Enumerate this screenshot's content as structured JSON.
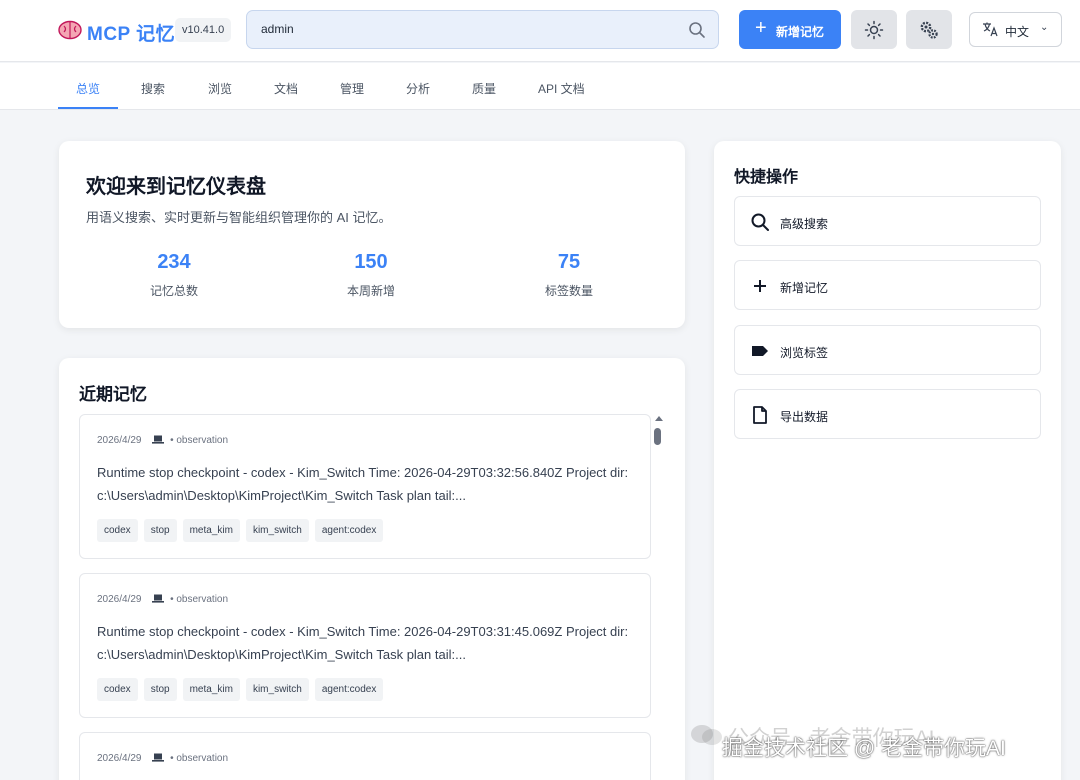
{
  "header": {
    "brand": "MCP 记忆",
    "version": "v10.41.0",
    "search_value": "admin",
    "new_memory_label": "新增记忆",
    "language_label": "中文"
  },
  "tabs": [
    {
      "label": "总览",
      "active": true
    },
    {
      "label": "搜索"
    },
    {
      "label": "浏览"
    },
    {
      "label": "文档"
    },
    {
      "label": "管理"
    },
    {
      "label": "分析"
    },
    {
      "label": "质量"
    },
    {
      "label": "API 文档"
    }
  ],
  "welcome": {
    "title": "欢迎来到记忆仪表盘",
    "subtitle": "用语义搜索、实时更新与智能组织管理你的 AI 记忆。",
    "stats": [
      {
        "value": "234",
        "label": "记忆总数"
      },
      {
        "value": "150",
        "label": "本周新增"
      },
      {
        "value": "75",
        "label": "标签数量"
      }
    ]
  },
  "recent": {
    "title": "近期记忆",
    "items": [
      {
        "date": "2026/4/29",
        "type": "• observation",
        "text": "Runtime stop checkpoint - codex - Kim_Switch Time: 2026-04-29T03:32:56.840Z Project dir: c:\\Users\\admin\\Desktop\\KimProject\\Kim_Switch Task plan tail:...",
        "tags": [
          "codex",
          "stop",
          "meta_kim",
          "kim_switch",
          "agent:codex"
        ]
      },
      {
        "date": "2026/4/29",
        "type": "• observation",
        "text": "Runtime stop checkpoint - codex - Kim_Switch Time: 2026-04-29T03:31:45.069Z Project dir: c:\\Users\\admin\\Desktop\\KimProject\\Kim_Switch Task plan tail:...",
        "tags": [
          "codex",
          "stop",
          "meta_kim",
          "kim_switch",
          "agent:codex"
        ]
      },
      {
        "date": "2026/4/29",
        "type": "• observation"
      }
    ]
  },
  "quick_actions": {
    "title": "快捷操作",
    "items": [
      {
        "label": "高级搜索",
        "icon": "search-icon"
      },
      {
        "label": "新增记忆",
        "icon": "plus-icon"
      },
      {
        "label": "浏览标签",
        "icon": "tag-icon"
      },
      {
        "label": "导出数据",
        "icon": "file-icon"
      }
    ]
  },
  "watermark": {
    "line1": "公众号 · 老金带你玩AI",
    "line2": "掘金技术社区 @ 老金带你玩AI"
  },
  "colors": {
    "accent": "#3b82f6",
    "background": "#f3f5f8"
  }
}
